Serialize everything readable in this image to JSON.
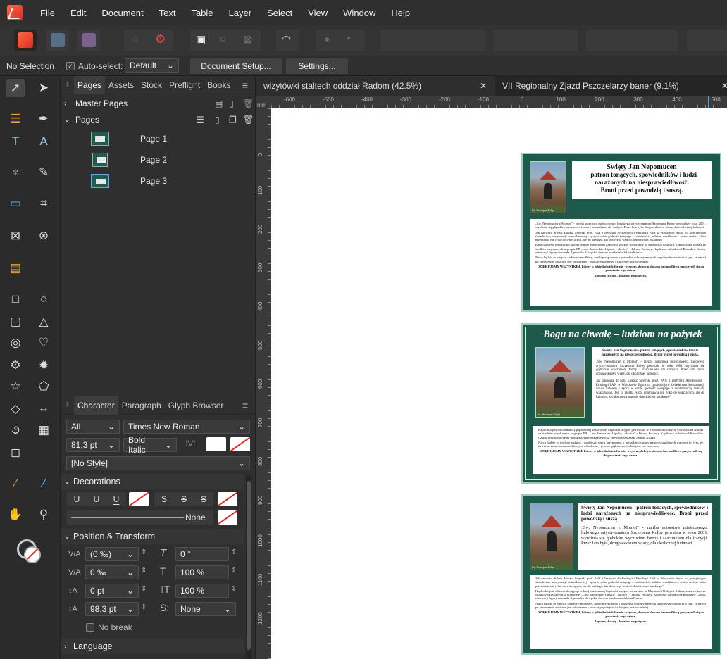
{
  "menu": [
    "File",
    "Edit",
    "Document",
    "Text",
    "Table",
    "Layer",
    "Select",
    "View",
    "Window",
    "Help"
  ],
  "context": {
    "selection": "No Selection",
    "auto_select_label": "Auto-select:",
    "auto_select_value": "Default",
    "document_setup": "Document Setup...",
    "settings": "Settings..."
  },
  "pages_panel": {
    "tabs": [
      "Pages",
      "Assets",
      "Stock",
      "Preflight",
      "Books"
    ],
    "master_pages": "Master Pages",
    "pages": "Pages",
    "page_list": [
      "Page 1",
      "Page 2",
      "Page 3"
    ]
  },
  "character_panel": {
    "tabs": [
      "Character",
      "Paragraph",
      "Glyph Browser"
    ],
    "language_select": "All",
    "font": "Times New Roman",
    "size": "81,3 pt",
    "style": "Bold Italic",
    "paragraph_style": "[No Style]",
    "decorations": "Decorations",
    "underline_label": "U",
    "strike_label": "S",
    "line_none": "None",
    "position_transform": "Position & Transform",
    "tracking": "(0 ‰)",
    "kerning": "0 ‰",
    "baseline": "0 pt",
    "leading": "98,3 pt",
    "shear": "0 °",
    "scale_h": "100 %",
    "scale_v": "100 %",
    "typography": "None",
    "no_break": "No break",
    "language": "Language"
  },
  "doc_tabs": [
    "wizytówki staltech oddział Radom (42.5%)",
    "VII Regionalny Zjazd Pszczelarzy baner (9.1%)"
  ],
  "ruler": {
    "unit": "mm",
    "h_labels": [
      "-600",
      "-500",
      "-400",
      "-300",
      "-200",
      "-100",
      "0",
      "100",
      "200",
      "300",
      "400",
      "500"
    ],
    "v_labels": [
      "0",
      "100",
      "200",
      "300",
      "400",
      "500",
      "600",
      "700",
      "800",
      "900",
      "1000",
      "1100",
      "1200"
    ]
  },
  "artboards": {
    "a1_title": [
      "Święty Jan Nepomucen",
      "- patron tonących, spowiedników i ludzi",
      "narażonych na niesprawiedliwość.",
      "Broni przed powodzią i suszą."
    ],
    "a2_heading": "Bogu na chwałę – ludziom na pożytek",
    "a2_title": "Święty Jan Nepomucen - patron tonących, spowiedników i ludzi narażonych na niesprawiedliwość. Broni przed powodzią i suszą.",
    "a3_title": "Święty Jan Nepomucen - patron tonących, spowiedników i ludzi narażonych na niesprawiedliwość. Broni przed powodzią i suszą.",
    "p1": "„Św. Nepomucen z Momot\" - rzeźba autorstwa miejscowego, ludowego artysty-amatora Szczepana Kołpy powstała w roku 2001, wyróżnia się głębokim wyczuciem formy i szacunkiem dla tradycji. Przez lata była, drogowskazem wiary, dla okolicznej ludności.",
    "p2": "Jak zauważa dr hab. Łukasz Smyrski prof. PAN z Instytutu Archeologii i Etnologii PAN w Warszawie figura to „przejmujące świadectwo kontynuacji sztuki ludowej - łączy w sobie godność świętego z subtelnością ludzkiej wrażliwości. Jest to rzeźba, która przemawia nie tylko do wierzących, ale do każdego, kto dostrzega wartość dziedzictwa lokalnego\"",
    "p3": "Kapliczka jest rekonstrukcją poprzedniej zniszczonej kapliczki stojącej pierwotnie w Momotach Dolnych. Odtworzona została ze środków uzyskanych w grupie FB „Lasy Janowskie, Lipskie i okolice\" - Jakuba Puchoty. Kapliczkę odbudował Radosław Czuba, renowacji figury dokonała Agnieszka Kawęcka, drewno przekazała Jolanta Kiszka.",
    "p4": "Niech będzie to miejsce zadumy i modlitwy, niech przypomina o potrzebie ochrony naszych wspólnych wartości i o tym, że nawet po zniszczeniu możliwe jest odrodzenie - jeszcze piękniejsze i silniejsze, niż wcześniej.",
    "thanks": "DZIĘKUJEMY WSZYSTKIM, którzy w jakiejkolwiek formie - czynem, dobrym słowem lub modlitwą przyczynili się do powstania tego dzieła.",
    "motto": "Bogu na chwałę – ludziom na pożytek.",
    "caption": "fot. Szczepan Kołpa"
  },
  "colors": {
    "artboard_green": "#1e5a4b",
    "accent_red": "#d82c2c"
  }
}
